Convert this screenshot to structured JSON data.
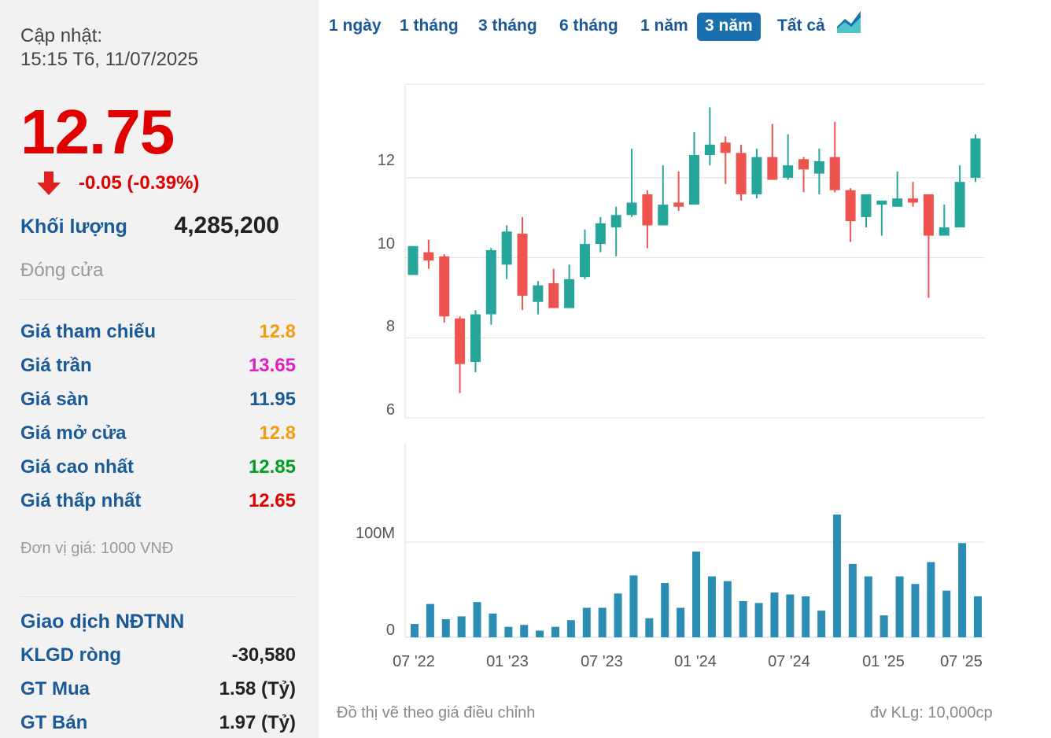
{
  "summary": {
    "updated_label": "Cập nhật:",
    "updated_time": "15:15 T6, 11/07/2025",
    "price": "12.75",
    "change": "-0.05 (-0.39%)",
    "volume_label": "Khối lượng",
    "volume_value": "4,285,200",
    "status": "Đóng cửa"
  },
  "price_rows": [
    {
      "label": "Giá tham chiếu",
      "value": "12.8",
      "color": "#f39c12"
    },
    {
      "label": "Giá trần",
      "value": "13.65",
      "color": "#e020c8"
    },
    {
      "label": "Giá sàn",
      "value": "11.95",
      "color": "#1a5a96"
    },
    {
      "label": "Giá mở cửa",
      "value": "12.8",
      "color": "#f39c12"
    },
    {
      "label": "Giá cao nhất",
      "value": "12.85",
      "color": "#00a020"
    },
    {
      "label": "Giá thấp nhất",
      "value": "12.65",
      "color": "#e00000"
    }
  ],
  "unit_note": "Đơn vị giá: 1000 VNĐ",
  "foreign": {
    "title": "Giao dịch NĐTNN",
    "rows": [
      {
        "label": "KLGD ròng",
        "value": "-30,580"
      },
      {
        "label": "GT Mua",
        "value": "1.58 (Tỷ)"
      },
      {
        "label": "GT Bán",
        "value": "1.97 (Tỷ)"
      }
    ]
  },
  "tabs": [
    {
      "label": "1 ngày",
      "active": false
    },
    {
      "label": "1 tháng",
      "active": false
    },
    {
      "label": "3 tháng",
      "active": false
    },
    {
      "label": "6 tháng",
      "active": false
    },
    {
      "label": "1 năm",
      "active": false
    },
    {
      "label": "3 năm",
      "active": true
    },
    {
      "label": "Tất cả",
      "active": false
    }
  ],
  "icons": {
    "chart_toggle": "area-chart-icon",
    "price_down": "down-arrow-icon"
  },
  "colors": {
    "up": "#26a69a",
    "down": "#ef5350",
    "volume": "#2b8cb4",
    "accent": "#1a6fae",
    "price_down": "#e00000"
  },
  "footer": {
    "note": "Đồ thị vẽ theo giá điều chỉnh",
    "unit": "đv KLg: 10,000cp"
  },
  "chart_data": [
    {
      "type": "candlestick",
      "title": "",
      "x_tick_labels": [
        "07 '22",
        "01 '23",
        "07 '23",
        "01 '24",
        "07 '24",
        "01 '25",
        "07 '25"
      ],
      "y_tick_labels": [
        "6",
        "8",
        "10",
        "12"
      ],
      "ylim": [
        5.8,
        14.0
      ],
      "grid": true,
      "candles": [
        {
          "o": 9.45,
          "h": 10.15,
          "l": 9.45,
          "c": 10.15
        },
        {
          "o": 10.0,
          "h": 10.3,
          "l": 9.6,
          "c": 9.8
        },
        {
          "o": 9.9,
          "h": 9.95,
          "l": 8.3,
          "c": 8.45
        },
        {
          "o": 8.4,
          "h": 8.45,
          "l": 6.6,
          "c": 7.3
        },
        {
          "o": 7.35,
          "h": 8.6,
          "l": 7.1,
          "c": 8.5
        },
        {
          "o": 8.5,
          "h": 10.1,
          "l": 8.25,
          "c": 10.05
        },
        {
          "o": 9.7,
          "h": 10.65,
          "l": 9.35,
          "c": 10.5
        },
        {
          "o": 10.45,
          "h": 10.85,
          "l": 8.6,
          "c": 8.95
        },
        {
          "o": 8.8,
          "h": 9.3,
          "l": 8.5,
          "c": 9.2
        },
        {
          "o": 9.25,
          "h": 9.6,
          "l": 8.65,
          "c": 8.65
        },
        {
          "o": 8.65,
          "h": 9.7,
          "l": 8.65,
          "c": 9.35
        },
        {
          "o": 9.4,
          "h": 10.55,
          "l": 9.35,
          "c": 10.2
        },
        {
          "o": 10.2,
          "h": 10.85,
          "l": 10.0,
          "c": 10.7
        },
        {
          "o": 10.6,
          "h": 11.1,
          "l": 9.9,
          "c": 10.9
        },
        {
          "o": 10.9,
          "h": 12.5,
          "l": 10.85,
          "c": 11.2
        },
        {
          "o": 11.4,
          "h": 11.5,
          "l": 10.1,
          "c": 10.65
        },
        {
          "o": 10.65,
          "h": 12.1,
          "l": 10.65,
          "c": 11.15
        },
        {
          "o": 11.2,
          "h": 11.95,
          "l": 11.0,
          "c": 11.1
        },
        {
          "o": 11.15,
          "h": 12.9,
          "l": 11.15,
          "c": 12.35
        },
        {
          "o": 12.35,
          "h": 13.5,
          "l": 12.1,
          "c": 12.6
        },
        {
          "o": 12.65,
          "h": 12.8,
          "l": 11.65,
          "c": 12.4
        },
        {
          "o": 12.4,
          "h": 12.6,
          "l": 11.25,
          "c": 11.4
        },
        {
          "o": 11.4,
          "h": 12.5,
          "l": 11.3,
          "c": 12.3
        },
        {
          "o": 12.3,
          "h": 13.1,
          "l": 11.75,
          "c": 11.75
        },
        {
          "o": 11.8,
          "h": 12.85,
          "l": 11.75,
          "c": 12.1
        },
        {
          "o": 12.25,
          "h": 12.3,
          "l": 11.45,
          "c": 12.0
        },
        {
          "o": 11.9,
          "h": 12.5,
          "l": 11.4,
          "c": 12.2
        },
        {
          "o": 12.3,
          "h": 13.15,
          "l": 11.45,
          "c": 11.5
        },
        {
          "o": 11.5,
          "h": 11.55,
          "l": 10.25,
          "c": 10.75
        },
        {
          "o": 10.85,
          "h": 11.4,
          "l": 10.6,
          "c": 11.4
        },
        {
          "o": 11.15,
          "h": 11.2,
          "l": 10.4,
          "c": 11.25
        },
        {
          "o": 11.1,
          "h": 11.95,
          "l": 11.1,
          "c": 11.3
        },
        {
          "o": 11.3,
          "h": 11.7,
          "l": 11.1,
          "c": 11.2
        },
        {
          "o": 11.4,
          "h": 11.4,
          "l": 8.9,
          "c": 10.4
        },
        {
          "o": 10.4,
          "h": 11.15,
          "l": 10.4,
          "c": 10.6
        },
        {
          "o": 10.6,
          "h": 12.1,
          "l": 10.6,
          "c": 11.7
        },
        {
          "o": 11.8,
          "h": 12.85,
          "l": 11.7,
          "c": 12.75
        }
      ]
    },
    {
      "type": "bar",
      "title": "",
      "series_name": "",
      "y_tick_labels": [
        "0",
        "100M"
      ],
      "ylim": [
        0,
        128
      ],
      "values": [
        14,
        35,
        19,
        22,
        37,
        25,
        11,
        13,
        7,
        11,
        18,
        31,
        31,
        46,
        65,
        20,
        57,
        31,
        90,
        64,
        59,
        38,
        36,
        47,
        45,
        43,
        28,
        129,
        77,
        64,
        23,
        64,
        56,
        79,
        49,
        99,
        43
      ],
      "x_tick_labels": [
        "07 '22",
        "01 '23",
        "07 '23",
        "01 '24",
        "07 '24",
        "01 '25",
        "07 '25"
      ]
    }
  ]
}
